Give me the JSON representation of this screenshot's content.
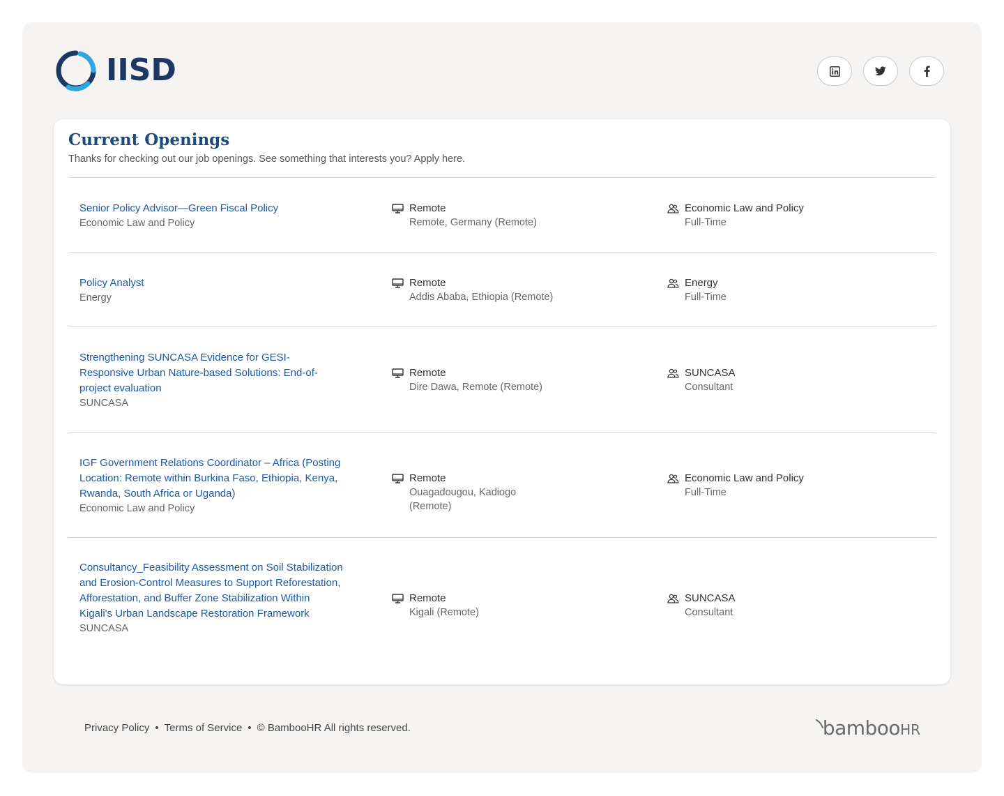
{
  "brand": {
    "logo_text": "IISD"
  },
  "social": [
    {
      "name": "linkedin-icon"
    },
    {
      "name": "twitter-icon"
    },
    {
      "name": "facebook-icon"
    }
  ],
  "openings": {
    "title": "Current Openings",
    "subtitle": "Thanks for checking out our job openings. See something that interests you? Apply here.",
    "jobs": [
      {
        "title": "Senior Policy Advisor—Green Fiscal Policy",
        "department": "Economic Law and Policy",
        "location_type": "Remote",
        "location": "Remote, Germany (Remote)",
        "team": "Economic Law and Policy",
        "employment": "Full-Time"
      },
      {
        "title": "Policy Analyst",
        "department": "Energy",
        "location_type": "Remote",
        "location": "Addis Ababa, Ethiopia (Remote)",
        "team": "Energy",
        "employment": "Full-Time"
      },
      {
        "title": "Strengthening SUNCASA Evidence for GESI-Responsive Urban Nature-based Solutions: End-of-project evaluation",
        "department": "SUNCASA",
        "location_type": "Remote",
        "location": "Dire Dawa, Remote (Remote)",
        "team": "SUNCASA",
        "employment": "Consultant"
      },
      {
        "title": "IGF Government Relations Coordinator – Africa (Posting Location: Remote within Burkina Faso, Ethiopia, Kenya, Rwanda, South Africa or Uganda)",
        "department": "Economic Law and Policy",
        "location_type": "Remote",
        "location": "Ouagadougou, Kadiogo (Remote)",
        "team": "Economic Law and Policy",
        "employment": "Full-Time"
      },
      {
        "title": "Consultancy_Feasibility Assessment on Soil Stabilization and Erosion-Control Measures to Support Reforestation, Afforestation, and Buffer Zone Stabilization Within Kigali's Urban Landscape Restoration Framework",
        "department": "SUNCASA",
        "location_type": "Remote",
        "location": "Kigali (Remote)",
        "team": "SUNCASA",
        "employment": "Consultant"
      }
    ]
  },
  "footer": {
    "privacy": "Privacy Policy",
    "separator": "•",
    "terms": "Terms of Service",
    "copyright": "© BambooHR All rights reserved.",
    "brand_main": "bamboo",
    "brand_hr": "HR"
  },
  "colors": {
    "link": "#1a5aa8",
    "heading": "#1e4a7a",
    "logo": "#1e3763",
    "logo_ring": "#2ea6e0"
  }
}
